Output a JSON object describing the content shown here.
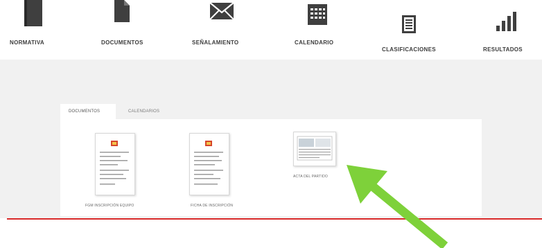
{
  "nav": {
    "items": [
      {
        "label": "NORMATIVA",
        "icon": "book-icon"
      },
      {
        "label": "DOCUMENTOS",
        "icon": "document-icon"
      },
      {
        "label": "SEÑALAMIENTO",
        "icon": "envelope-icon"
      },
      {
        "label": "CALENDARIO",
        "icon": "calendar-icon"
      },
      {
        "label": "CLASIFICACIONES",
        "icon": "list-icon"
      },
      {
        "label": "RESULTADOS",
        "icon": "bar-chart-icon"
      }
    ]
  },
  "tabs": [
    {
      "label": "DOCUMENTOS",
      "active": true
    },
    {
      "label": "CALENDARIOS",
      "active": false
    }
  ],
  "documents": [
    {
      "label": "FGM INSCRIPCIÓN EQUIPO"
    },
    {
      "label": "FICHA DE INSCRIPCIÓN"
    },
    {
      "label": "ACTA DEL PARTIDO"
    }
  ],
  "colors": {
    "accent_red": "#d92a2a",
    "arrow_green": "#7ed13a",
    "band_gray": "#f1f1f1"
  }
}
